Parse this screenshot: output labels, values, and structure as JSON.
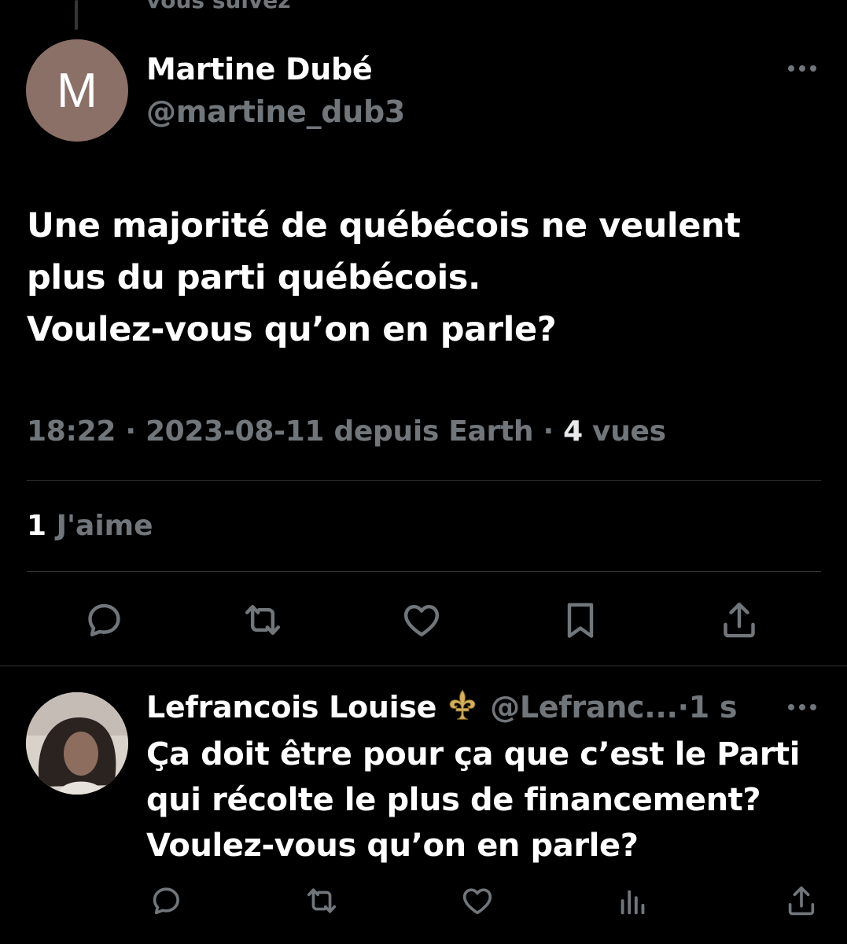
{
  "context": {
    "text": "vous suivez"
  },
  "tweet": {
    "avatar_letter": "M",
    "author_name": "Martine Dubé",
    "author_handle": "@martine_dub3",
    "text": "Une majorité de québécois ne veulent\nplus du parti québécois.\nVoulez-vous qu’on en parle?",
    "time": "18:22",
    "date": "2023-08-11",
    "source": "depuis Earth",
    "views_count": "4",
    "views_label": "vues",
    "likes_count": "1",
    "likes_label": "J'aime",
    "actions": [
      "reply-icon",
      "retweet-icon",
      "like-icon",
      "bookmark-icon",
      "share-icon"
    ]
  },
  "reply": {
    "author_name": "Lefrancois Louise",
    "author_handle": "@Lefranc...",
    "separator": "·",
    "time_ago": "1 s",
    "text": "Ça doit être pour ça que c’est le Parti\nqui récolte le plus de financement?\nVoulez-vous qu’on en parle?",
    "actions": [
      "reply-icon",
      "retweet-icon",
      "like-icon",
      "views-icon",
      "share-icon"
    ]
  },
  "colors": {
    "background": "#000000",
    "text": "#e7e9ea",
    "muted": "#71767b",
    "divider": "#2f3336",
    "avatar": "#8b7068"
  }
}
